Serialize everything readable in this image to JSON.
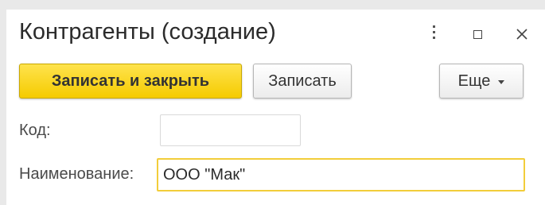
{
  "window": {
    "title": "Контрагенты (создание)"
  },
  "toolbar": {
    "save_close_label": "Записать и закрыть",
    "save_label": "Записать",
    "more_label": "Еще"
  },
  "form": {
    "code": {
      "label": "Код:",
      "value": ""
    },
    "name": {
      "label": "Наименование:",
      "value": "ООО \"Мак\""
    }
  },
  "colors": {
    "primary_button": "#f5cb00",
    "focus_border": "#f2cd3a"
  }
}
